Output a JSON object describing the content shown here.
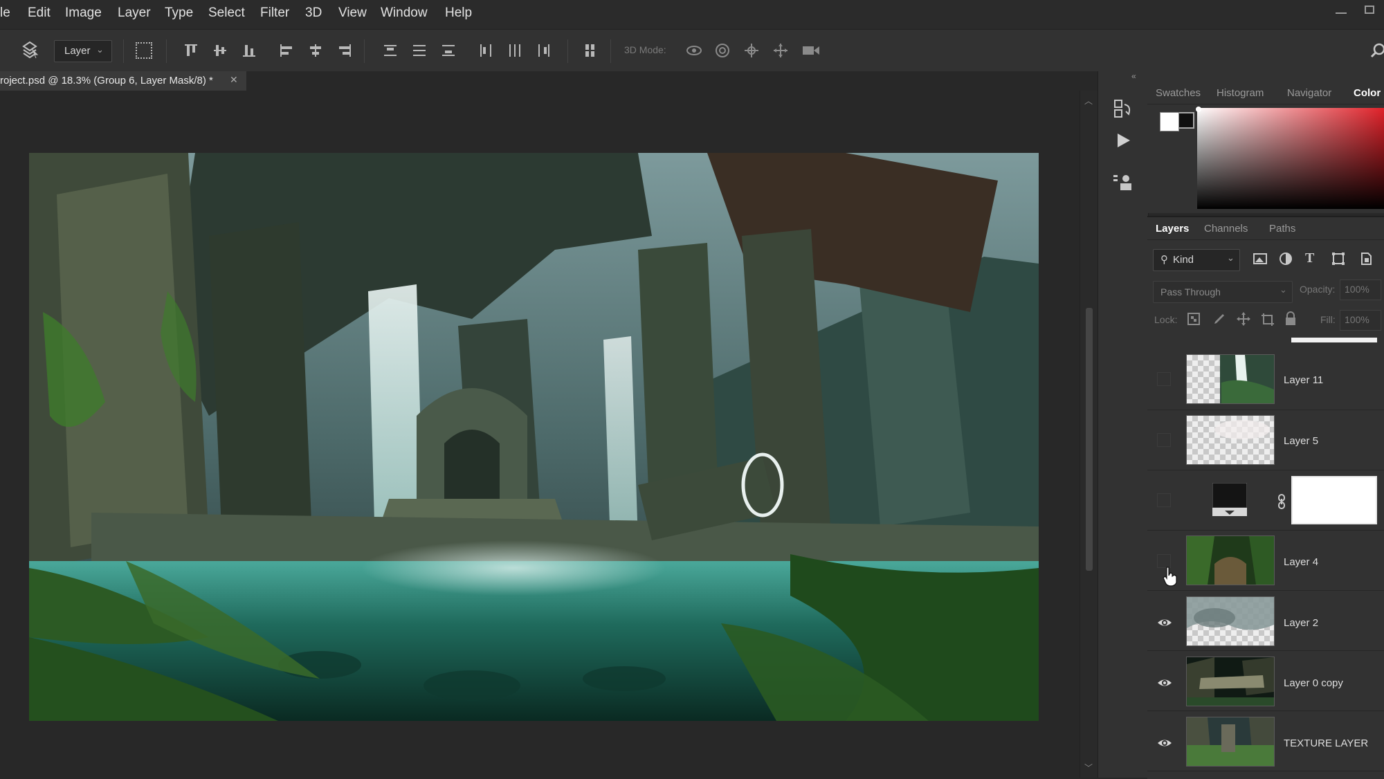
{
  "menu": [
    "le",
    "Edit",
    "Image",
    "Layer",
    "Type",
    "Select",
    "Filter",
    "3D",
    "View",
    "Window",
    "Help"
  ],
  "options_bar": {
    "layer_select": "Layer",
    "mode_label": "3D Mode:"
  },
  "document": {
    "tab_title": "roject.psd @ 18.3% (Group 6, Layer Mask/8) *",
    "close_glyph": "✕"
  },
  "color_panel": {
    "tabs": [
      "Swatches",
      "Histogram",
      "Navigator",
      "Color"
    ],
    "active_tab": "Color"
  },
  "layers_panel": {
    "tabs": [
      "Layers",
      "Channels",
      "Paths"
    ],
    "active_tab": "Layers",
    "filter_label": "Kind",
    "blend_mode": "Pass Through",
    "opacity_label": "Opacity:",
    "opacity_value": "100%",
    "lock_label": "Lock:",
    "fill_label": "Fill:",
    "fill_value": "100%",
    "layers": [
      {
        "name": "Layer 11",
        "visible": false
      },
      {
        "name": "Layer 5",
        "visible": false
      },
      {
        "name": "",
        "visible": false
      },
      {
        "name": "Layer 4",
        "visible": false
      },
      {
        "name": "Layer 2",
        "visible": true
      },
      {
        "name": "Layer 0 copy",
        "visible": true
      },
      {
        "name": "TEXTURE LAYER",
        "visible": true
      }
    ]
  },
  "colors": {
    "app_bg": "#282828",
    "panel_bg": "#323232",
    "accent_red": "#e0222a"
  }
}
